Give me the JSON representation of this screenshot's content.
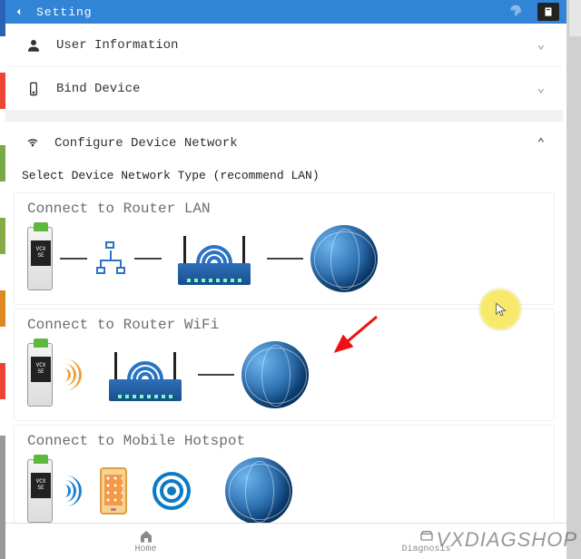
{
  "header": {
    "title": "Setting"
  },
  "menu": {
    "user_info": "User Information",
    "bind_device": "Bind Device"
  },
  "network": {
    "header": "Configure Device Network",
    "subtitle": "Select Device Network Type (recommend LAN)",
    "options": {
      "lan": "Connect to Router LAN",
      "wifi": "Connect to Router WiFi",
      "hotspot": "Connect to Mobile Hotspot"
    }
  },
  "device_label_line1": "VCX",
  "device_label_line2": "SE",
  "nav": {
    "home": "Home",
    "diagnosis": "Diagnosis"
  },
  "watermark": "VXDIAGSHOP"
}
